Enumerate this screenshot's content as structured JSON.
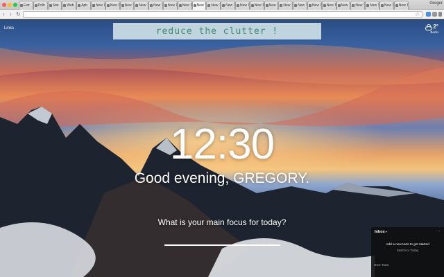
{
  "browser": {
    "tabs": [
      {
        "label": "Extr"
      },
      {
        "label": "Polh"
      },
      {
        "label": "Star"
      },
      {
        "label": "Web"
      },
      {
        "label": "Apb"
      },
      {
        "label": "New To"
      },
      {
        "label": "New To"
      },
      {
        "label": "New To"
      },
      {
        "label": "New To"
      },
      {
        "label": "New To"
      },
      {
        "label": "New To"
      },
      {
        "label": "New To"
      },
      {
        "label": "New Tc"
      },
      {
        "label": "New To"
      },
      {
        "label": "New To"
      },
      {
        "label": "New To"
      },
      {
        "label": "New To"
      },
      {
        "label": "New To"
      },
      {
        "label": "New To"
      },
      {
        "label": "New To"
      },
      {
        "label": "New To"
      },
      {
        "label": "New To"
      },
      {
        "label": "New To"
      },
      {
        "label": "New To"
      },
      {
        "label": "New To"
      },
      {
        "label": "New To"
      },
      {
        "label": "New To"
      }
    ],
    "active_tab_index": 12,
    "profile_name": "Gregor",
    "address": "",
    "accent_colors": {
      "close": "#fc5f57",
      "minimize": "#fdbc2e",
      "maximize": "#28c840"
    }
  },
  "links_label": "Links",
  "banner_text": "reduce the clutter !",
  "weather": {
    "temp": "2°",
    "location": "Berlin",
    "icon": "cloud-sun-icon"
  },
  "clock": "12:30",
  "greeting": "Good evening, GREGORY.",
  "focus": {
    "question": "What is your main focus for today?",
    "value": ""
  },
  "todo": {
    "list_name": "Inbox",
    "more": "···",
    "empty_message": "Add a new todo to get started",
    "switch_label": "Switch to Today",
    "input_placeholder": "New Todo"
  }
}
